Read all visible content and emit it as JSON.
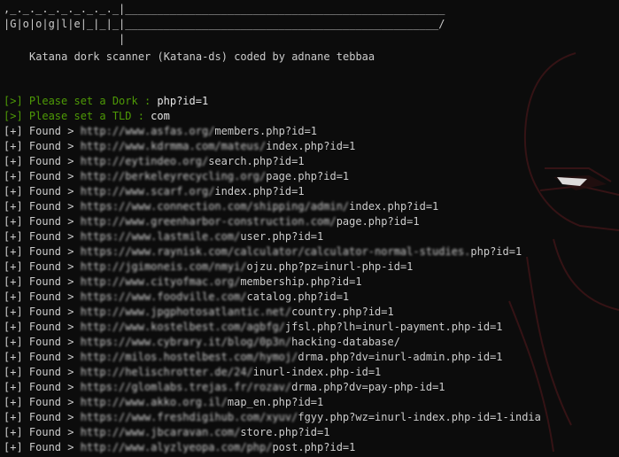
{
  "banner": {
    "line1": ",_._._._._._._._._|__________________________________________________",
    "line2": "|G|o|o|g|l|e|_|_|_|_________________________________________________/",
    "line3": "                  |",
    "credit": "Katana dork scanner (Katana-ds) coded by adnane tebbaa"
  },
  "prompts": [
    {
      "label": "[>] Please set a Dork : ",
      "value": "php?id=1"
    },
    {
      "label": "[>] Please set a TLD : ",
      "value": "com"
    }
  ],
  "found_prefix": "[+] Found > ",
  "results": [
    {
      "blurred": "http://www.asfas.org/",
      "path": "members.php?id=1"
    },
    {
      "blurred": "http://www.kdrmma.com/mateus/",
      "path": "index.php?id=1"
    },
    {
      "blurred": "http://eytindeo.org/",
      "path": "search.php?id=1"
    },
    {
      "blurred": "http://berkeleyrecycling.org/",
      "path": "page.php?id=1"
    },
    {
      "blurred": "http://www.scarf.org/",
      "path": "index.php?id=1"
    },
    {
      "blurred": "https://www.connection.com/shipping/admin/",
      "path": "index.php?id=1"
    },
    {
      "blurred": "http://www.greenharbor-construction.com/",
      "path": "page.php?id=1"
    },
    {
      "blurred": "https://www.lastmile.com/",
      "path": "user.php?id=1"
    },
    {
      "blurred": "https://www.raynisk.com/calculator/calculator-normal-studies.",
      "path": "php?id=1"
    },
    {
      "blurred": "http://jgimoneis.com/nmyi/",
      "path": "ojzu.php?pz=inurl-php-id=1"
    },
    {
      "blurred": "http://www.cityofmac.org/",
      "path": "membership.php?id=1"
    },
    {
      "blurred": "https://www.foodville.com/",
      "path": "catalog.php?id=1"
    },
    {
      "blurred": "http://www.jpgphotosatlantic.net/",
      "path": "country.php?id=1"
    },
    {
      "blurred": "http://www.kostelbest.com/agbfg/",
      "path": "jfsl.php?lh=inurl-payment.php-id=1"
    },
    {
      "blurred": "https://www.cybrary.it/blog/0p3n/",
      "path": "hacking-database/"
    },
    {
      "blurred": "http://milos.hostelbest.com/hymoj/",
      "path": "drma.php?dv=inurl-admin.php-id=1"
    },
    {
      "blurred": "http://helischrotter.de/24/",
      "path": "inurl-index.php-id=1"
    },
    {
      "blurred": "https://glomlabs.trejas.fr/rozav/",
      "path": "drma.php?dv=pay-php-id=1"
    },
    {
      "blurred": "http://www.akko.org.il/",
      "path": "map_en.php?id=1"
    },
    {
      "blurred": "https://www.freshdigihub.com/xyuv/",
      "path": "fgyy.php?wz=inurl-index.php-id=1-india"
    },
    {
      "blurred": "http://www.jbcaravan.com/",
      "path": "store.php?id=1"
    },
    {
      "blurred": "http://www.alyzlyeopa.com/php/",
      "path": "post.php?id=1"
    }
  ],
  "colors": {
    "background": "#0c0c0c",
    "prompt_green": "#4e9a06",
    "text": "#cccccc"
  }
}
